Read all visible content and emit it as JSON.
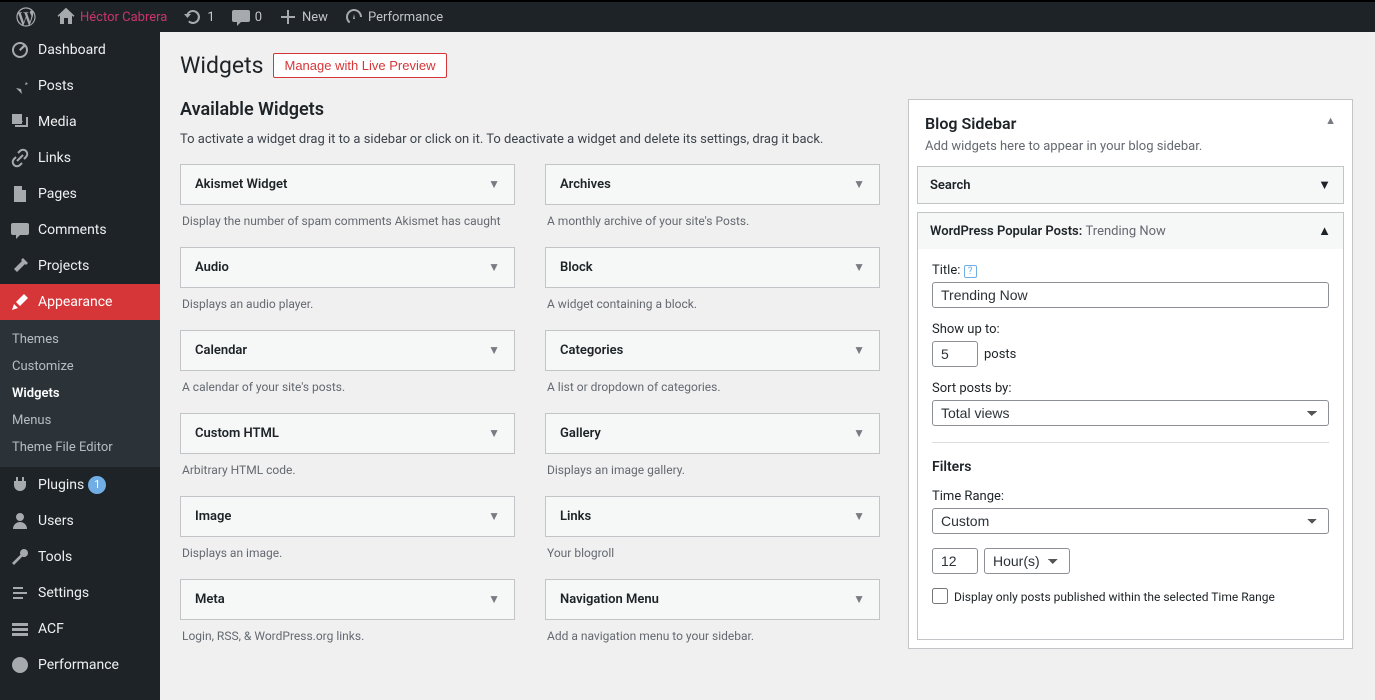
{
  "adminbar": {
    "site_name": "Héctor Cabrera",
    "updates_count": "1",
    "comments_count": "0",
    "new_label": "New",
    "performance_label": "Performance"
  },
  "menu": {
    "dashboard": "Dashboard",
    "posts": "Posts",
    "media": "Media",
    "links": "Links",
    "pages": "Pages",
    "comments": "Comments",
    "projects": "Projects",
    "appearance": "Appearance",
    "appearance_sub": {
      "themes": "Themes",
      "customize": "Customize",
      "widgets": "Widgets",
      "menus": "Menus",
      "theme_file_editor": "Theme File Editor"
    },
    "plugins": "Plugins",
    "plugins_badge": "1",
    "users": "Users",
    "tools": "Tools",
    "settings": "Settings",
    "acf": "ACF",
    "performance": "Performance"
  },
  "page": {
    "title": "Widgets",
    "live_preview": "Manage with Live Preview",
    "available_heading": "Available Widgets",
    "available_desc": "To activate a widget drag it to a sidebar or click on it. To deactivate a widget and delete its settings, drag it back."
  },
  "available": [
    {
      "title": "Akismet Widget",
      "desc": "Display the number of spam comments Akismet has caught"
    },
    {
      "title": "Archives",
      "desc": "A monthly archive of your site's Posts."
    },
    {
      "title": "Audio",
      "desc": "Displays an audio player."
    },
    {
      "title": "Block",
      "desc": "A widget containing a block."
    },
    {
      "title": "Calendar",
      "desc": "A calendar of your site's posts."
    },
    {
      "title": "Categories",
      "desc": "A list or dropdown of categories."
    },
    {
      "title": "Custom HTML",
      "desc": "Arbitrary HTML code."
    },
    {
      "title": "Gallery",
      "desc": "Displays an image gallery."
    },
    {
      "title": "Image",
      "desc": "Displays an image."
    },
    {
      "title": "Links",
      "desc": "Your blogroll"
    },
    {
      "title": "Meta",
      "desc": "Login, RSS, & WordPress.org links."
    },
    {
      "title": "Navigation Menu",
      "desc": "Add a navigation menu to your sidebar."
    }
  ],
  "sidebar_panel": {
    "title": "Blog Sidebar",
    "desc": "Add widgets here to appear in your blog sidebar.",
    "widget_search": "Search",
    "widget_wpp_name": "WordPress Popular Posts:",
    "widget_wpp_sub": "Trending Now",
    "form": {
      "title_label": "Title:",
      "title_value": "Trending Now",
      "showupto_label": "Show up to:",
      "showupto_value": "5",
      "showupto_suffix": "posts",
      "sortby_label": "Sort posts by:",
      "sortby_value": "Total views",
      "filters_heading": "Filters",
      "timerange_label": "Time Range:",
      "timerange_value": "Custom",
      "timerange_qty": "12",
      "timerange_unit": "Hour(s)",
      "only_published_label": "Display only posts published within the selected Time Range"
    }
  }
}
